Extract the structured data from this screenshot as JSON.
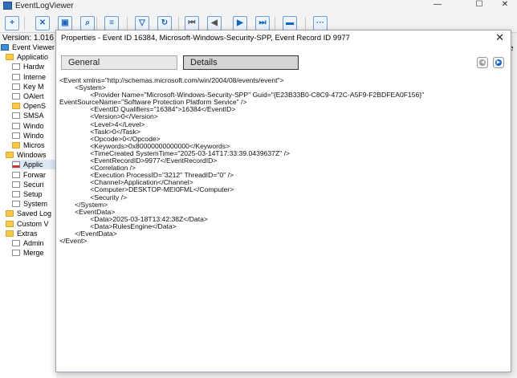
{
  "window": {
    "title": "EventLogViewer",
    "minimize_glyph": "—",
    "maximize_glyph": "☐",
    "close_glyph": "✕"
  },
  "toolbar": {
    "buttons": [
      {
        "icon": "add-icon",
        "glyph": "+",
        "color": "#1565c0"
      },
      {
        "icon": "remove-icon",
        "glyph": "✕",
        "color": "#1565c0"
      },
      {
        "icon": "save-icon",
        "glyph": "▣",
        "color": "#1565c0"
      },
      {
        "icon": "search-icon",
        "glyph": "⌕",
        "color": "#1565c0"
      },
      {
        "icon": "list-icon",
        "glyph": "≡",
        "color": "#1565c0"
      },
      {
        "icon": "filter-icon",
        "glyph": "▽",
        "color": "#1565c0"
      },
      {
        "icon": "refresh-icon",
        "glyph": "↻",
        "color": "#1565c0"
      },
      {
        "icon": "first-icon",
        "glyph": "⏮",
        "color": "#555"
      },
      {
        "icon": "previous-icon",
        "glyph": "◀",
        "color": "#555"
      },
      {
        "icon": "next-icon",
        "glyph": "▶",
        "color": "#1565c0"
      },
      {
        "icon": "last-icon",
        "glyph": "⏭",
        "color": "#1565c0"
      },
      {
        "icon": "panel-icon",
        "glyph": "▬",
        "color": "#1565c0"
      },
      {
        "icon": "more-icon",
        "glyph": "···",
        "color": "#1565c0"
      }
    ]
  },
  "version_text": "Version: 1.016 (",
  "right_edge_text": "e",
  "tree": {
    "items": [
      {
        "label": "Event Viewer (",
        "icon": "monitor"
      },
      {
        "label": "Applicatio",
        "icon": "folder"
      },
      {
        "label": "Hardw",
        "icon": "log"
      },
      {
        "label": "Interne",
        "icon": "log"
      },
      {
        "label": "Key M",
        "icon": "log"
      },
      {
        "label": "OAlert",
        "icon": "log"
      },
      {
        "label": "OpenS",
        "icon": "folder"
      },
      {
        "label": "SMSA",
        "icon": "log"
      },
      {
        "label": "Windo",
        "icon": "log"
      },
      {
        "label": "Windo",
        "icon": "log"
      },
      {
        "label": "Micros",
        "icon": "folder"
      },
      {
        "label": "Windows",
        "icon": "folder"
      },
      {
        "label": "Applic",
        "icon": "log-sel"
      },
      {
        "label": "Forwar",
        "icon": "log"
      },
      {
        "label": "Securi",
        "icon": "log"
      },
      {
        "label": "Setup",
        "icon": "log"
      },
      {
        "label": "System",
        "icon": "log"
      },
      {
        "label": "Saved Log",
        "icon": "folder"
      },
      {
        "label": "Custom V",
        "icon": "folder"
      },
      {
        "label": "Extras",
        "icon": "folder"
      },
      {
        "label": "Admin",
        "icon": "log"
      },
      {
        "label": "Merge",
        "icon": "log"
      }
    ]
  },
  "dialog": {
    "title": "Properties - Event ID 16384, Microsoft-Windows-Security-SPP, Event Record ID 9977",
    "close_glyph": "✕",
    "tabs": [
      {
        "label": "General",
        "active": false
      },
      {
        "label": "Details",
        "active": true
      }
    ],
    "prev_glyph": "◀",
    "next_glyph": "▶",
    "xml_lines": [
      "<Event xmlns=\"http://schemas.microsoft.com/win/2004/08/events/event\">",
      "        <System>",
      "                <Provider Name=\"Microsoft-Windows-Security-SPP\" Guid=\"{E23B33B0-C8C9-472C-A5F9-F2BDFEA0F156}\"",
      "EventSourceName=\"Software Protection Platform Service\" />",
      "                <EventID Qualifiers=\"16384\">16384</EventID>",
      "                <Version>0</Version>",
      "                <Level>4</Level>",
      "                <Task>0</Task>",
      "                <Opcode>0</Opcode>",
      "                <Keywords>0x80000000000000</Keywords>",
      "                <TimeCreated SystemTime=\"2025-03-14T17:33:39.0439637Z\" />",
      "                <EventRecordID>9977</EventRecordID>",
      "                <Correlation />",
      "                <Execution ProcessID=\"3212\" ThreadID=\"0\" />",
      "                <Channel>Application</Channel>",
      "                <Computer>DESKTOP-MEI0FML</Computer>",
      "                <Security />",
      "        </System>",
      "        <EventData>",
      "                <Data>2025-03-18T13:42:38Z</Data>",
      "                <Data>RulesEngine</Data>",
      "        </EventData>",
      "</Event>"
    ]
  }
}
